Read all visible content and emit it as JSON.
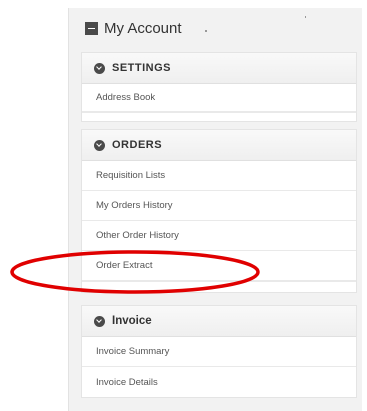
{
  "account": {
    "title": "My Account"
  },
  "sections": [
    {
      "header": "SETTINGS",
      "items": [
        "Address Book"
      ]
    },
    {
      "header": "ORDERS",
      "items": [
        "Requisition Lists",
        "My Orders History",
        "Other Order History",
        "Order Extract"
      ]
    },
    {
      "header": "Invoice",
      "items": [
        "Invoice Summary",
        "Invoice Details"
      ]
    }
  ],
  "annotation": {
    "shape": "ellipse",
    "color": "#e00000",
    "target": "Order Extract"
  },
  "icons": {
    "title": "minus-square-icon",
    "section": "chevron-circle-down-icon"
  }
}
